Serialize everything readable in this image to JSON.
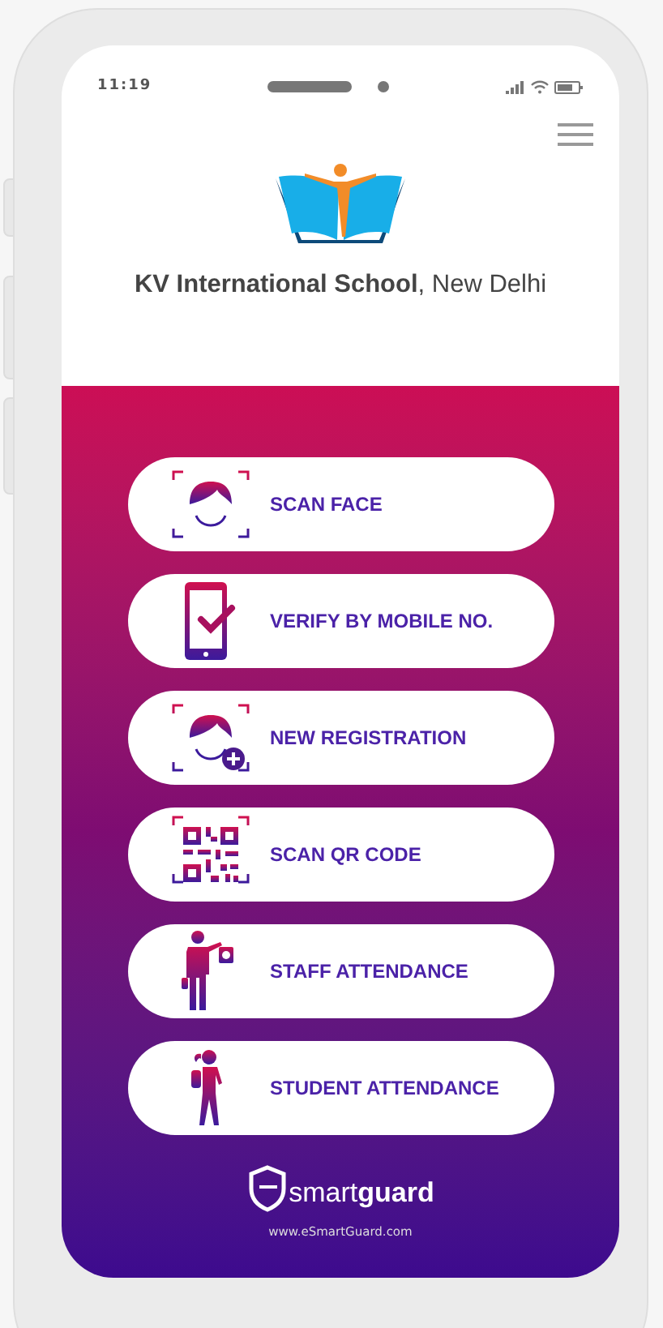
{
  "status_bar": {
    "time": "11:19"
  },
  "header": {
    "title": "**KV International School**, New Delhi"
  },
  "actions": [
    {
      "kind": "face",
      "label": "SCAN FACE"
    },
    {
      "kind": "mobile",
      "label": "VERIFY BY MOBILE NO."
    },
    {
      "kind": "face-plus",
      "label": "NEW REGISTRATION"
    },
    {
      "kind": "qr",
      "label": "SCAN QR CODE"
    },
    {
      "kind": "staff",
      "label": "STAFF ATTENDANCE"
    },
    {
      "kind": "student",
      "label": "STUDENT ATTENDANCE"
    }
  ],
  "footer": {
    "brand": "smart**guard**",
    "url": "www.eSmartGuard.com"
  }
}
